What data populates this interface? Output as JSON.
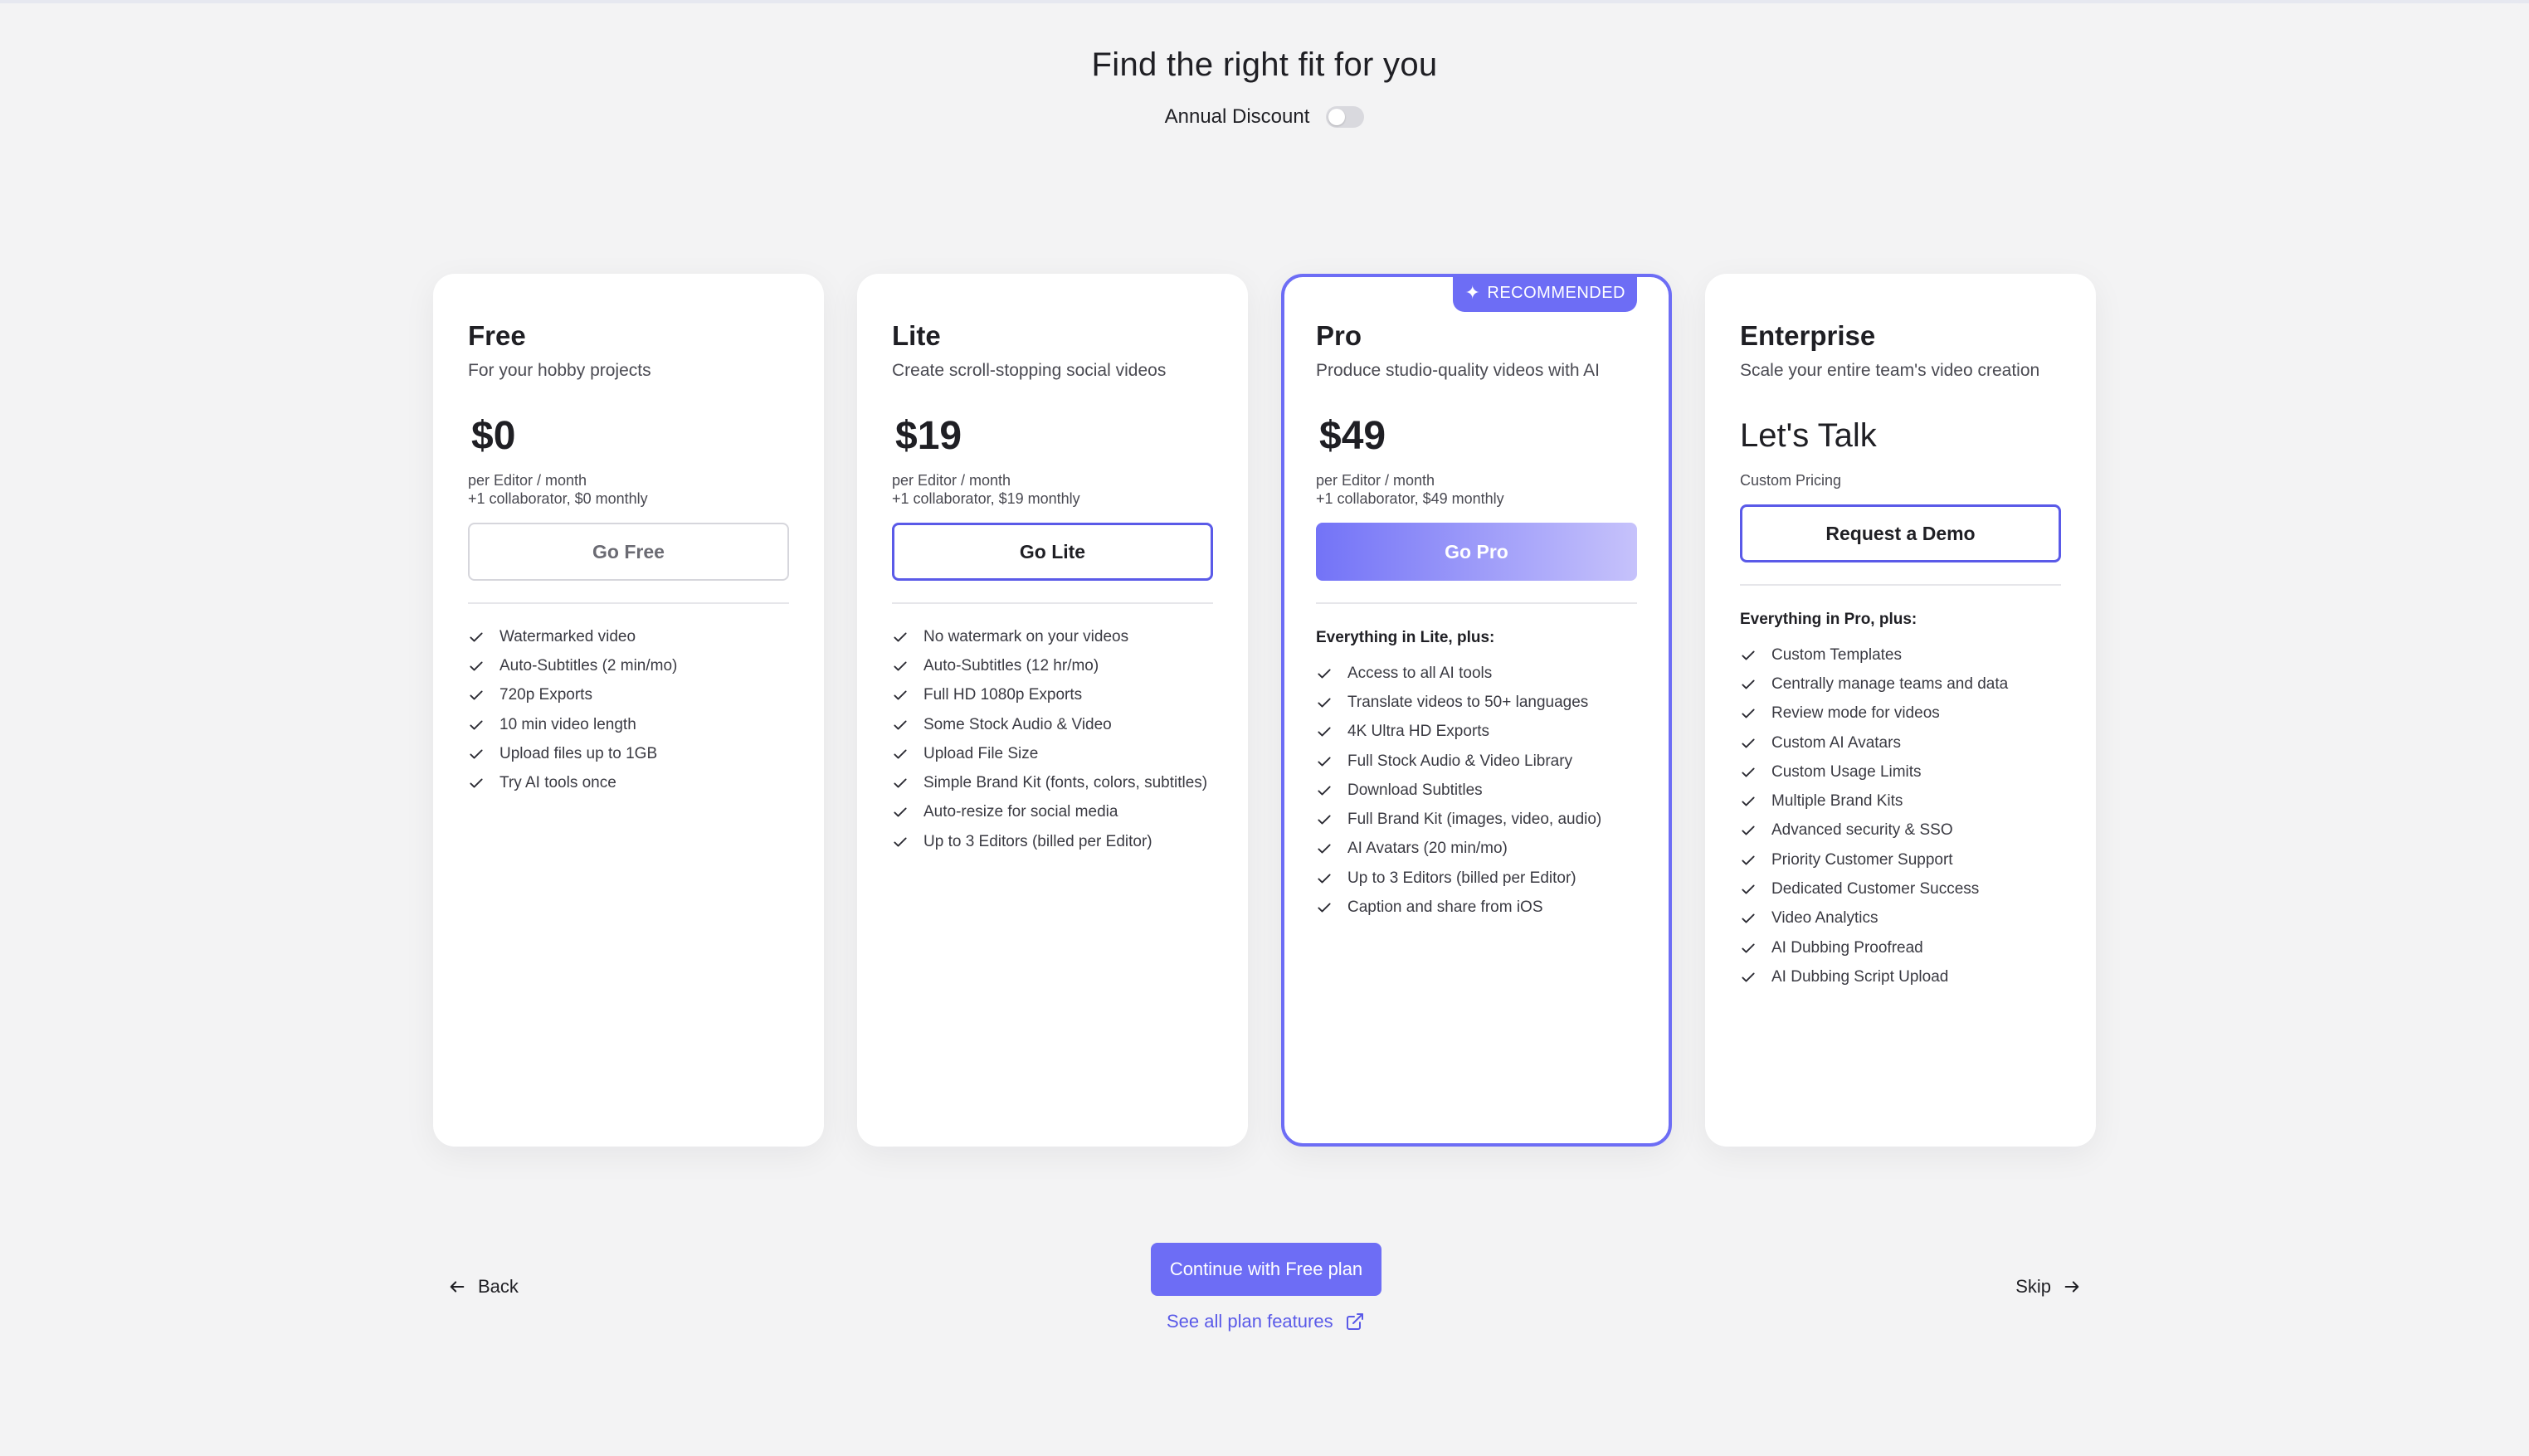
{
  "header": {
    "title": "Find the right fit for you",
    "annual_discount_label": "Annual Discount",
    "annual_discount_on": false
  },
  "plans": [
    {
      "name": "Free",
      "description": "For your hobby projects",
      "price": "$0",
      "price_line1": "per Editor / month",
      "price_line2": "+1 collaborator, $0 monthly",
      "button": "Go Free",
      "features_heading": "",
      "features": [
        "Watermarked video",
        "Auto-Subtitles (2 min/mo)",
        "720p Exports",
        "10 min video length",
        "Upload files up to 1GB",
        "Try AI tools once"
      ]
    },
    {
      "name": "Lite",
      "description": "Create scroll-stopping social videos",
      "price": "$19",
      "price_line1": "per Editor / month",
      "price_line2": "+1 collaborator, $19 monthly",
      "button": "Go Lite",
      "features_heading": "",
      "features": [
        "No watermark on your videos",
        "Auto-Subtitles (12 hr/mo)",
        "Full HD 1080p Exports",
        "Some Stock Audio & Video",
        "Upload File Size",
        "Simple Brand Kit (fonts, colors, subtitles)",
        "Auto-resize for social media",
        "Up to 3 Editors (billed per Editor)"
      ]
    },
    {
      "name": "Pro",
      "badge": "RECOMMENDED",
      "description": "Produce studio-quality videos with AI",
      "price": "$49",
      "price_line1": "per Editor / month",
      "price_line2": "+1 collaborator, $49 monthly",
      "button": "Go Pro",
      "features_heading": "Everything in Lite, plus:",
      "features": [
        "Access to all AI tools",
        "Translate videos to 50+ languages",
        "4K Ultra HD Exports",
        "Full Stock Audio & Video Library",
        "Download Subtitles",
        "Full Brand Kit (images, video, audio)",
        "AI Avatars (20 min/mo)",
        "Up to 3 Editors (billed per Editor)",
        "Caption and share from iOS"
      ]
    },
    {
      "name": "Enterprise",
      "description": "Scale your entire team's video creation",
      "price": "Let's Talk",
      "price_line1": "Custom Pricing",
      "button": "Request a Demo",
      "features_heading": "Everything in Pro, plus:",
      "features": [
        "Custom Templates",
        "Centrally manage teams and data",
        "Review mode for videos",
        "Custom AI Avatars",
        "Custom Usage Limits",
        "Multiple Brand Kits",
        "Advanced security & SSO",
        "Priority Customer Support",
        "Dedicated Customer Success",
        "Video Analytics",
        "AI Dubbing Proofread",
        "AI Dubbing Script Upload"
      ]
    }
  ],
  "footer": {
    "back_label": "Back",
    "skip_label": "Skip",
    "continue_label": "Continue with Free plan",
    "see_all_label": "See all plan features"
  },
  "colors": {
    "accent": "#6d6df5",
    "background": "#f3f3f4",
    "card": "#ffffff"
  },
  "icons": {
    "check": "check-icon",
    "back": "arrow-left-icon",
    "skip": "arrow-right-icon",
    "external": "external-link-icon",
    "badge": "sparkle-icon"
  }
}
